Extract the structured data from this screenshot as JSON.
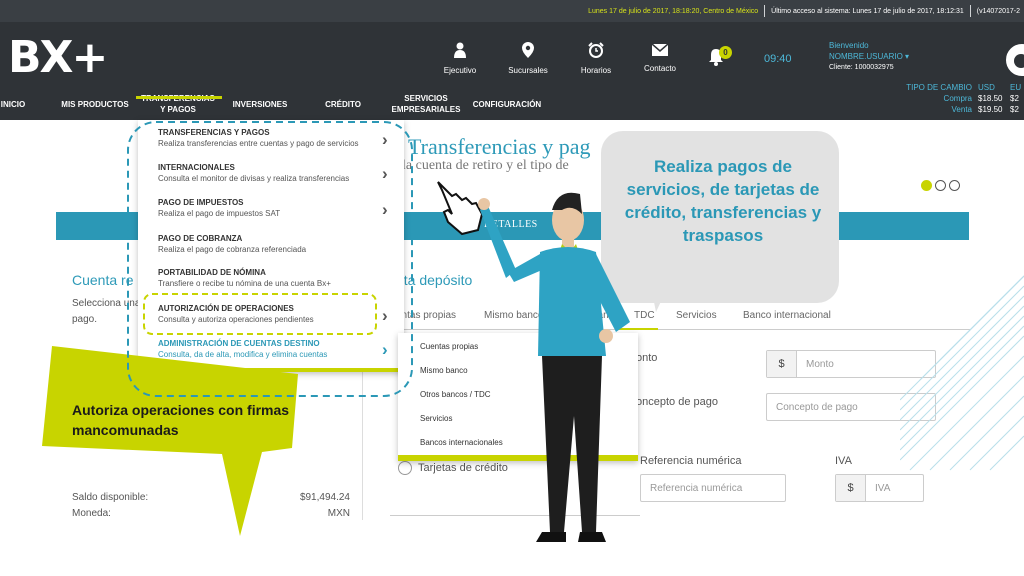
{
  "top_bar": {
    "date_text": "Lunes 17 de julio de 2017, 18:18:20, Centro de México",
    "last_access": "Último acceso al sistema: Lunes 17 de julio de 2017, 18:12:31",
    "version": "(v14072017-2"
  },
  "header": {
    "logo": "BX+",
    "icons": [
      {
        "name": "user-icon",
        "label": "Ejecutivo"
      },
      {
        "name": "location-pin-icon",
        "label": "Sucursales"
      },
      {
        "name": "alarm-clock-icon",
        "label": "Horarios"
      },
      {
        "name": "envelope-icon",
        "label": "Contacto"
      }
    ],
    "notifications_count": "0",
    "clock": "09:40",
    "welcome": "Bienvenido",
    "username": "NOMBRE.USUARIO ▾",
    "client": "Cliente: 1000032975"
  },
  "nav": {
    "items": [
      "INICIO",
      "MIS PRODUCTOS",
      "TRANSFERENCIAS Y PAGOS",
      "INVERSIONES",
      "CRÉDITO",
      "SERVICIOS EMPRESARIALES",
      "CONFIGURACIÓN"
    ]
  },
  "fx": {
    "title": "TIPO DE CAMBIO",
    "col_usd": "USD",
    "col_eur": "EU",
    "buy_label": "Compra",
    "buy_usd": "$18.50",
    "buy_eur": "$2",
    "sell_label": "Venta",
    "sell_usd": "$19.50",
    "sell_eur": "$2"
  },
  "page": {
    "title": "Transferencias y pag",
    "subtitle": "la cuenta de retiro y el tipo de",
    "details_bar": "DETALLES",
    "cuenta_retiro": "Cuenta re",
    "cuenta_retiro_help": "Selecciona una pago.",
    "cuenta_deposito": "nta depósito",
    "tabs": [
      "entas propias",
      "Mismo banco",
      "banco",
      "TDC",
      "Servicios",
      "Banco internacional"
    ],
    "fields": {
      "monto_label": "onto",
      "monto_prefix": "$",
      "monto_placeholder": "Monto",
      "concepto_label": "oncepto de pago",
      "concepto_placeholder": "Concepto de pago",
      "referencia_label": "Referencia numérica",
      "referencia_placeholder": "Referencia numérica",
      "iva_label": "IVA",
      "iva_prefix": "$",
      "iva_placeholder": "IVA"
    },
    "radio_label": "Tarjetas de crédito",
    "saldo_label": "Saldo disponible:",
    "saldo_value": "$91,494.24",
    "moneda_label": "Moneda:",
    "moneda_value": "MXN"
  },
  "dropdown": {
    "items": [
      {
        "title": "TRANSFERENCIAS Y PAGOS",
        "desc": "Realiza transferencias entre cuentas y pago de servicios",
        "arrow": true
      },
      {
        "title": "INTERNACIONALES",
        "desc": "Consulta el monitor de divisas y realiza transferencias",
        "arrow": true
      },
      {
        "title": "PAGO DE IMPUESTOS",
        "desc": "Realiza el pago de impuestos SAT",
        "arrow": true
      },
      {
        "title": "PAGO DE COBRANZA",
        "desc": "Realiza el pago de cobranza referenciada",
        "arrow": false
      },
      {
        "title": "PORTABILIDAD DE NÓMINA",
        "desc": "Transfiere o recibe tu nómina de una cuenta Bx+",
        "arrow": false
      },
      {
        "title": "AUTORIZACIÓN DE OPERACIONES",
        "desc": "Consulta y autoriza operaciones pendientes",
        "arrow": true
      },
      {
        "title": "ADMINISTRACIÓN DE CUENTAS DESTINO",
        "desc": "Consulta, da de alta, modifica y elimina cuentas",
        "arrow": true
      }
    ]
  },
  "submenu": {
    "items": [
      "Cuentas propias",
      "Mismo banco",
      "Otros bancos / TDC",
      "Servicios",
      "Bancos internacionales"
    ]
  },
  "callouts": {
    "green": "Autoriza operaciones con firmas mancomunadas",
    "bubble": "Realiza pagos de servicios, de tarjetas de crédito, transferencias y traspasos"
  },
  "colors": {
    "accent_green": "#c8d400",
    "accent_blue": "#2b98b6",
    "header_dark": "#2f3337"
  }
}
